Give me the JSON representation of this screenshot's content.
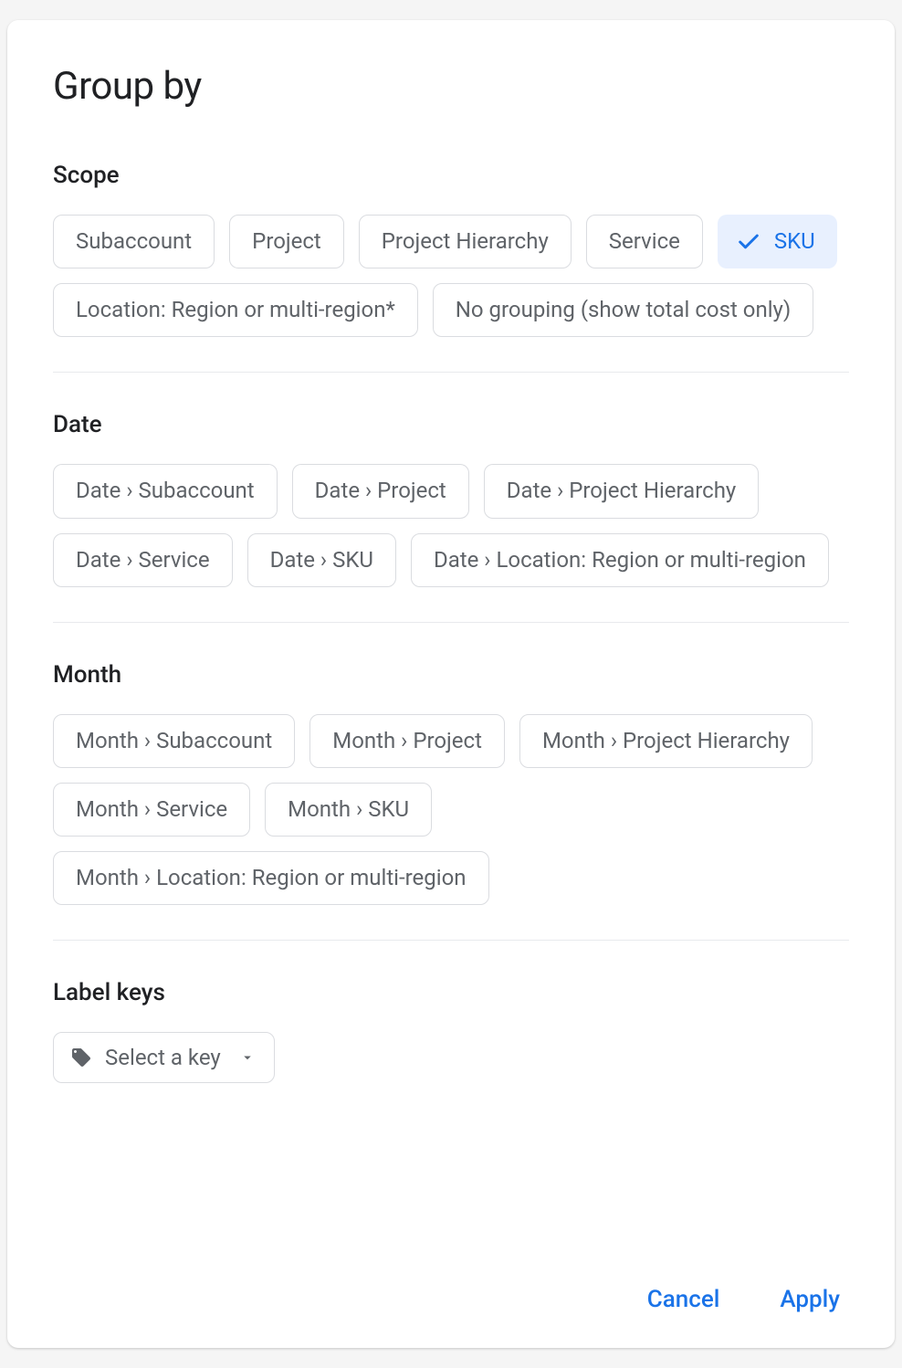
{
  "dialog": {
    "title": "Group by"
  },
  "sections": {
    "scope": {
      "heading": "Scope",
      "chips": [
        {
          "label": "Subaccount",
          "selected": false
        },
        {
          "label": "Project",
          "selected": false
        },
        {
          "label": "Project Hierarchy",
          "selected": false
        },
        {
          "label": "Service",
          "selected": false
        },
        {
          "label": "SKU",
          "selected": true
        },
        {
          "label": "Location: Region or multi-region*",
          "selected": false
        },
        {
          "label": "No grouping (show total cost only)",
          "selected": false
        }
      ]
    },
    "date": {
      "heading": "Date",
      "chips": [
        {
          "label": "Date › Subaccount",
          "selected": false
        },
        {
          "label": "Date › Project",
          "selected": false
        },
        {
          "label": "Date › Project Hierarchy",
          "selected": false
        },
        {
          "label": "Date › Service",
          "selected": false
        },
        {
          "label": "Date › SKU",
          "selected": false
        },
        {
          "label": "Date › Location: Region or multi-region",
          "selected": false
        }
      ]
    },
    "month": {
      "heading": "Month",
      "chips": [
        {
          "label": "Month › Subaccount",
          "selected": false
        },
        {
          "label": "Month › Project",
          "selected": false
        },
        {
          "label": "Month › Project Hierarchy",
          "selected": false
        },
        {
          "label": "Month › Service",
          "selected": false
        },
        {
          "label": "Month › SKU",
          "selected": false
        },
        {
          "label": "Month › Location: Region or multi-region",
          "selected": false
        }
      ]
    },
    "labelKeys": {
      "heading": "Label keys",
      "selectLabel": "Select a key"
    }
  },
  "actions": {
    "cancel": "Cancel",
    "apply": "Apply"
  }
}
